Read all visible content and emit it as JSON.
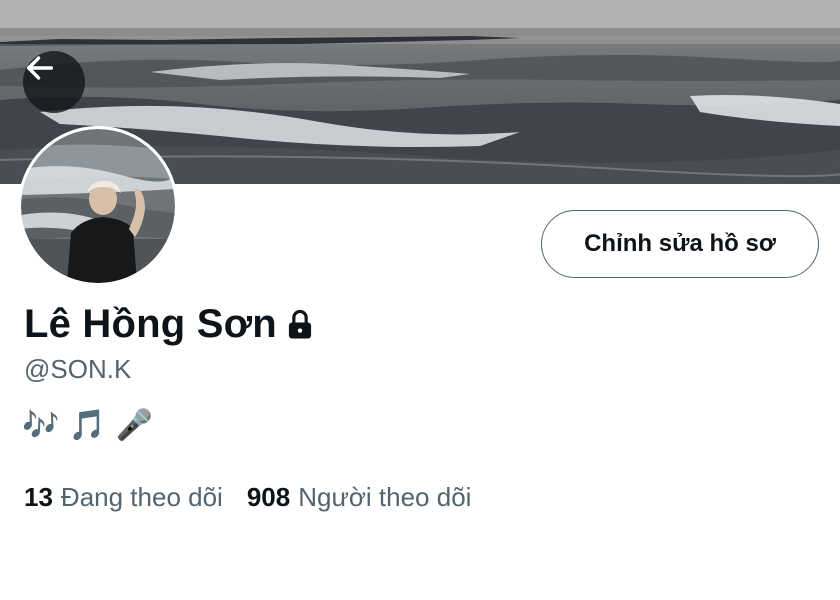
{
  "header": {
    "back_icon": "arrow-left-icon",
    "banner_image": "ocean-waves-photo"
  },
  "profile": {
    "avatar": "person-on-beach-photo",
    "edit_button_label": "Chỉnh sửa hồ sơ",
    "name": "Lê Hồng Sơn",
    "protected_icon": "lock-icon",
    "handle": "@SON.K",
    "bio": "🎶 🎵 🎤"
  },
  "stats": {
    "following_count": "13",
    "following_label": "Đang theo dõi",
    "followers_count": "908",
    "followers_label": "Người theo dõi"
  },
  "colors": {
    "text_primary": "#0f1419",
    "text_secondary": "#536471",
    "button_border": "#536471"
  }
}
